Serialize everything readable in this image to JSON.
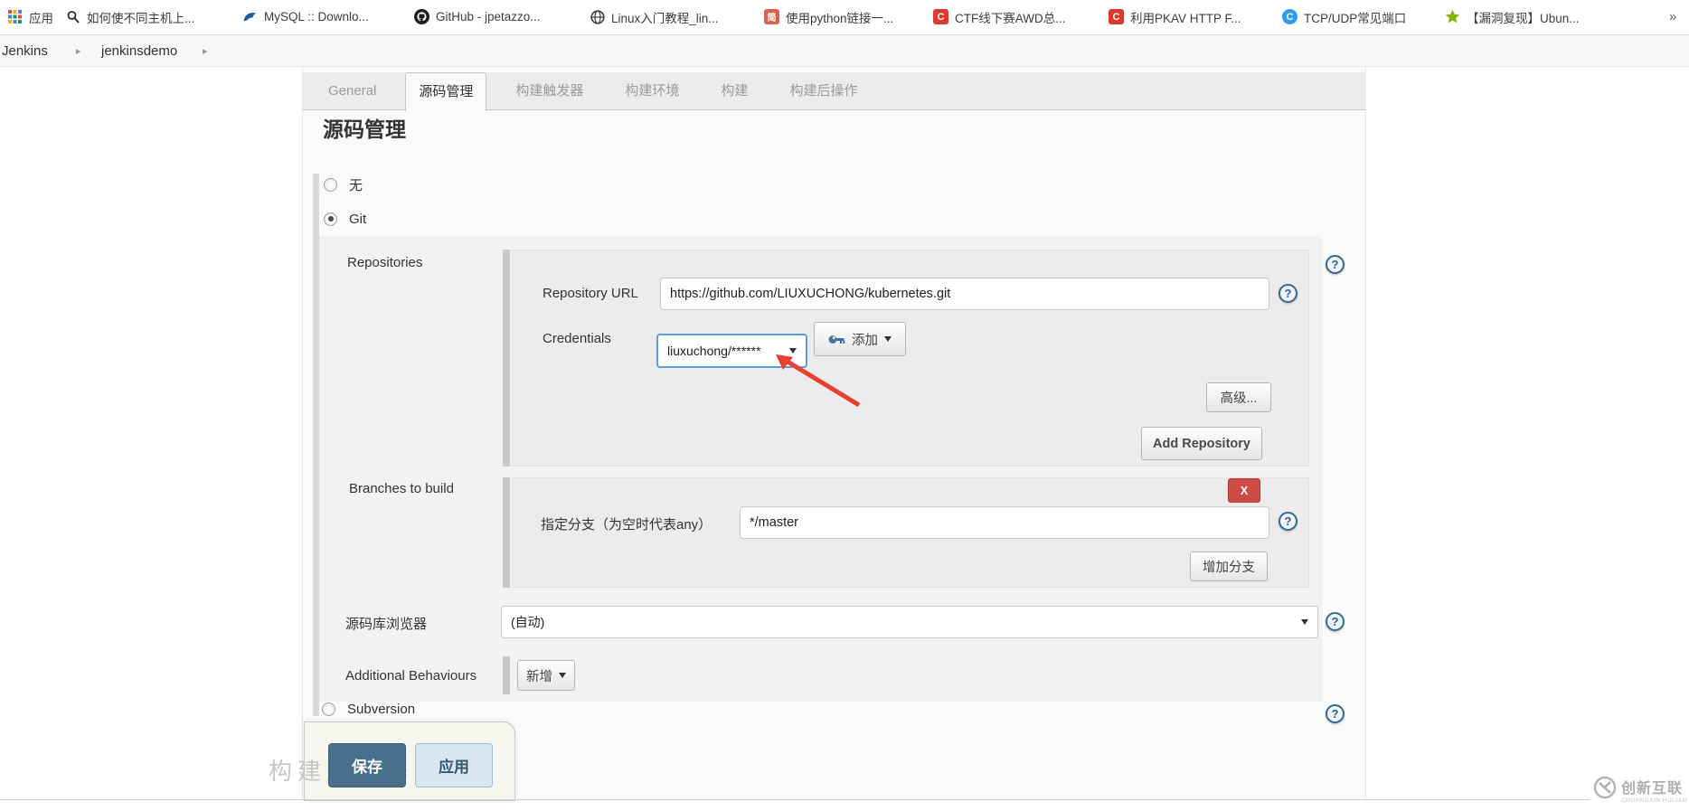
{
  "bookmarks_bar": {
    "items": [
      {
        "label": "应用",
        "icon": "apps-grid-icon"
      },
      {
        "label": "如何使不同主机上...",
        "icon": "magnifier-favicon"
      },
      {
        "label": "MySQL :: Downlo...",
        "icon": "mysql-favicon"
      },
      {
        "label": "GitHub - jpetazzo...",
        "icon": "github-favicon"
      },
      {
        "label": "Linux入门教程_lin...",
        "icon": "globe-favicon"
      },
      {
        "label": "使用python链接一...",
        "icon": "jianshu-favicon",
        "icon_text": "简"
      },
      {
        "label": "CTF线下赛AWD总...",
        "icon": "csdn-favicon",
        "icon_text": "C"
      },
      {
        "label": "利用PKAV HTTP F...",
        "icon": "csdn-favicon",
        "icon_text": "C"
      },
      {
        "label": "TCP/UDP常见端口",
        "icon": "blue-c-favicon",
        "icon_text": "C"
      },
      {
        "label": "【漏洞复现】Ubun...",
        "icon": "star-favicon"
      }
    ],
    "overflow": "»"
  },
  "breadcrumb": {
    "items": [
      "Jenkins",
      "jenkinsdemo"
    ],
    "separator": "▸"
  },
  "tabs": [
    {
      "label": "General",
      "active": false
    },
    {
      "label": "源码管理",
      "active": true
    },
    {
      "label": "构建触发器",
      "active": false
    },
    {
      "label": "构建环境",
      "active": false
    },
    {
      "label": "构建",
      "active": false
    },
    {
      "label": "构建后操作",
      "active": false
    }
  ],
  "page": {
    "heading": "源码管理",
    "help_icon_glyph": "?",
    "scm_options": [
      {
        "label": "无",
        "selected": false
      },
      {
        "label": "Git",
        "selected": true
      },
      {
        "label": "Subversion",
        "selected": false
      }
    ],
    "git": {
      "repositories_label": "Repositories",
      "repository_url_label": "Repository URL",
      "repository_url_value": "https://github.com/LIUXUCHONG/kubernetes.git",
      "credentials_label": "Credentials",
      "credentials_value": "liuxuchong/******",
      "add_credential_button": "添加",
      "advanced_button": "高级...",
      "add_repository_button": "Add Repository",
      "branches": {
        "section_label": "Branches to build",
        "remove_button": "X",
        "branch_spec_label": "指定分支（为空时代表any）",
        "branch_spec_value": "*/master",
        "add_branch_button": "增加分支"
      },
      "repo_browser_label": "源码库浏览器",
      "repo_browser_value": "(自动)",
      "additional_behaviours_label": "Additional Behaviours",
      "add_behaviour_button": "新增"
    },
    "footer": {
      "save_button": "保存",
      "apply_button": "应用",
      "obscured_text": "构建触发器"
    }
  },
  "watermark": {
    "title": "创新互联",
    "subtitle": "CHUANGXIN HULIAN"
  },
  "colors": {
    "focus_blue": "#5f9fd8",
    "danger_red": "#ce4a44",
    "save_teal": "#48708a",
    "arrow_red": "#e8402f"
  }
}
